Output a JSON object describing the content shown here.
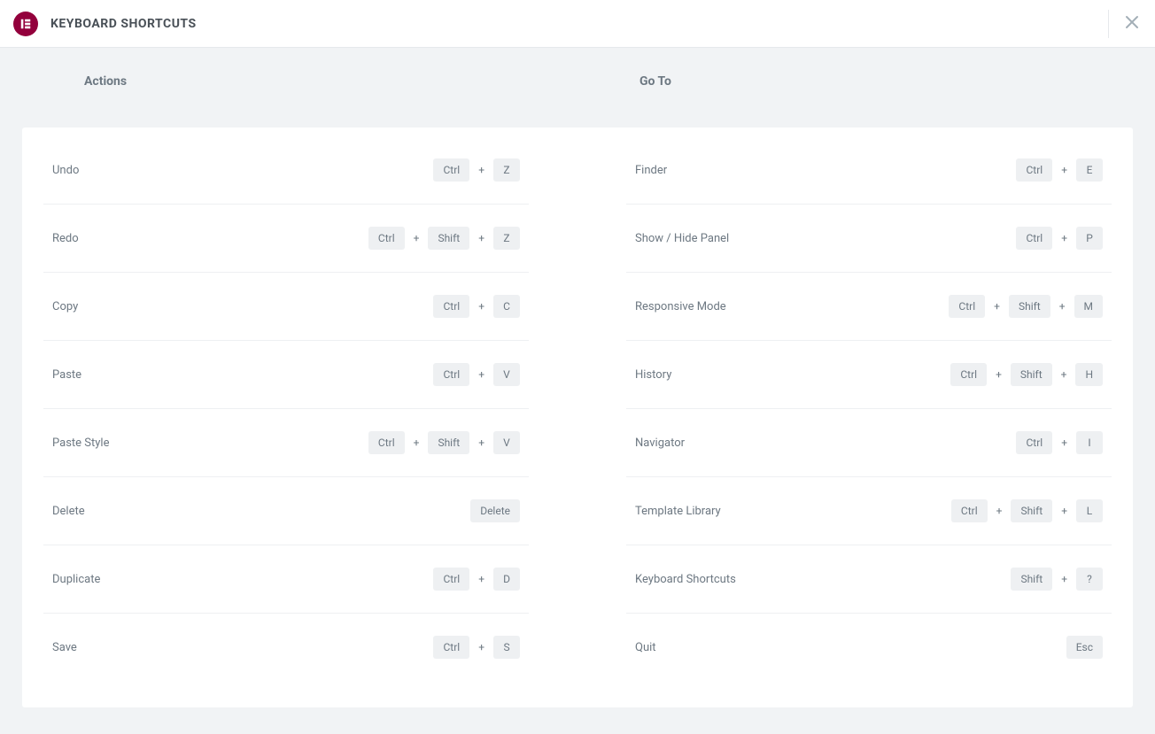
{
  "header": {
    "title": "KEYBOARD SHORTCUTS"
  },
  "sections": {
    "actions": {
      "title": "Actions",
      "items": [
        {
          "label": "Undo",
          "keys": [
            "Ctrl",
            "Z"
          ]
        },
        {
          "label": "Redo",
          "keys": [
            "Ctrl",
            "Shift",
            "Z"
          ]
        },
        {
          "label": "Copy",
          "keys": [
            "Ctrl",
            "C"
          ]
        },
        {
          "label": "Paste",
          "keys": [
            "Ctrl",
            "V"
          ]
        },
        {
          "label": "Paste Style",
          "keys": [
            "Ctrl",
            "Shift",
            "V"
          ]
        },
        {
          "label": "Delete",
          "keys": [
            "Delete"
          ]
        },
        {
          "label": "Duplicate",
          "keys": [
            "Ctrl",
            "D"
          ]
        },
        {
          "label": "Save",
          "keys": [
            "Ctrl",
            "S"
          ]
        }
      ]
    },
    "goto": {
      "title": "Go To",
      "items": [
        {
          "label": "Finder",
          "keys": [
            "Ctrl",
            "E"
          ]
        },
        {
          "label": "Show / Hide Panel",
          "keys": [
            "Ctrl",
            "P"
          ]
        },
        {
          "label": "Responsive Mode",
          "keys": [
            "Ctrl",
            "Shift",
            "M"
          ]
        },
        {
          "label": "History",
          "keys": [
            "Ctrl",
            "Shift",
            "H"
          ]
        },
        {
          "label": "Navigator",
          "keys": [
            "Ctrl",
            "I"
          ]
        },
        {
          "label": "Template Library",
          "keys": [
            "Ctrl",
            "Shift",
            "L"
          ]
        },
        {
          "label": "Keyboard Shortcuts",
          "keys": [
            "Shift",
            "?"
          ]
        },
        {
          "label": "Quit",
          "keys": [
            "Esc"
          ]
        }
      ]
    }
  }
}
